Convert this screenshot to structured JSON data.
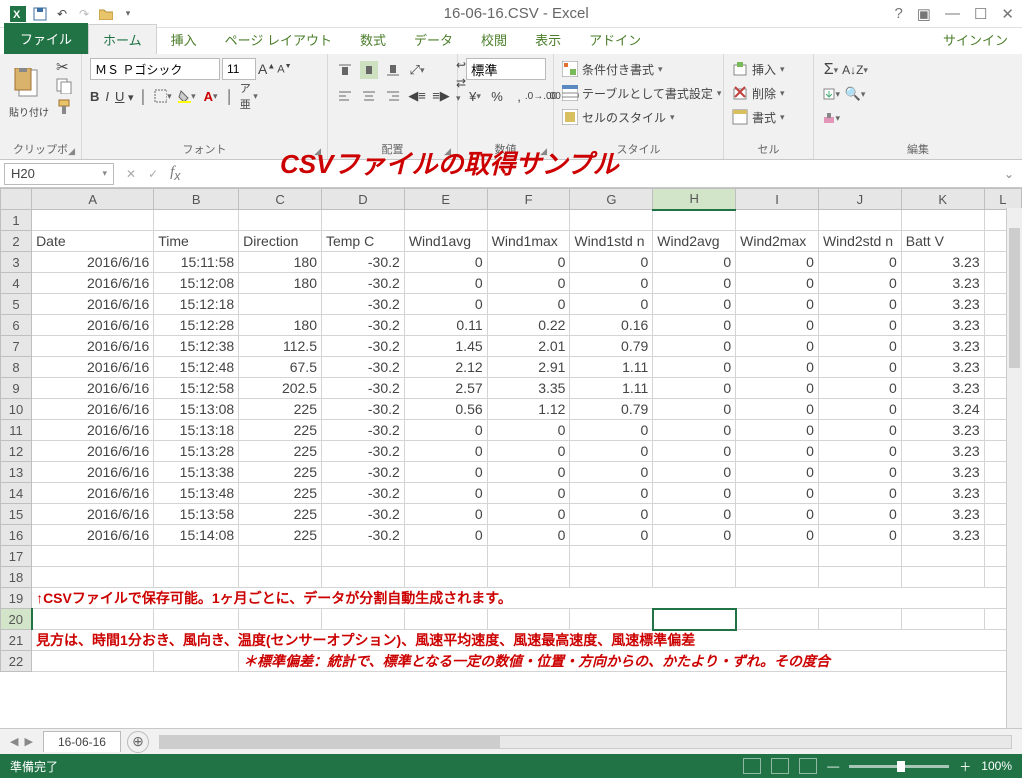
{
  "window": {
    "title": "16-06-16.CSV - Excel",
    "signin": "サインイン",
    "help_glyph": "?"
  },
  "tabs": {
    "file": "ファイル",
    "home": "ホーム",
    "insert": "挿入",
    "pagelayout": "ページ レイアウト",
    "formulas": "数式",
    "data": "データ",
    "review": "校閲",
    "view": "表示",
    "addin": "アドイン"
  },
  "ribbon": {
    "clipboard": {
      "paste": "貼り付け",
      "label": "クリップボード"
    },
    "font": {
      "name": "ＭＳ Ｐゴシック",
      "size": "11",
      "label": "フォント"
    },
    "alignment": {
      "label": "配置",
      "wrap_glyph": "↩",
      "merge_glyph": "⇄"
    },
    "number": {
      "format": "標準",
      "label": "数値"
    },
    "styles": {
      "cond": "条件付き書式",
      "table": "テーブルとして書式設定",
      "cell": "セルのスタイル",
      "label": "スタイル"
    },
    "cells": {
      "insert": "挿入",
      "delete": "削除",
      "format": "書式",
      "label": "セル"
    },
    "editing": {
      "label": "編集"
    }
  },
  "fbar": {
    "namebox": "H20",
    "cancel": "✕",
    "enter": "✓",
    "overlay": "CSVファイルの取得サンプル"
  },
  "columns": [
    "A",
    "B",
    "C",
    "D",
    "E",
    "F",
    "G",
    "H",
    "I",
    "J",
    "K",
    "L"
  ],
  "headers": [
    "Date",
    "Time",
    "Direction",
    "Temp C",
    "Wind1avg",
    "Wind1max",
    "Wind1std n",
    "Wind2avg",
    "Wind2max",
    "Wind2std n",
    "Batt V"
  ],
  "rows": [
    [
      "2016/6/16",
      "15:11:58",
      "180",
      "-30.2",
      "0",
      "0",
      "0",
      "0",
      "0",
      "0",
      "3.23"
    ],
    [
      "2016/6/16",
      "15:12:08",
      "180",
      "-30.2",
      "0",
      "0",
      "0",
      "0",
      "0",
      "0",
      "3.23"
    ],
    [
      "2016/6/16",
      "15:12:18",
      "",
      "-30.2",
      "0",
      "0",
      "0",
      "0",
      "0",
      "0",
      "3.23"
    ],
    [
      "2016/6/16",
      "15:12:28",
      "180",
      "-30.2",
      "0.11",
      "0.22",
      "0.16",
      "0",
      "0",
      "0",
      "3.23"
    ],
    [
      "2016/6/16",
      "15:12:38",
      "112.5",
      "-30.2",
      "1.45",
      "2.01",
      "0.79",
      "0",
      "0",
      "0",
      "3.23"
    ],
    [
      "2016/6/16",
      "15:12:48",
      "67.5",
      "-30.2",
      "2.12",
      "2.91",
      "1.11",
      "0",
      "0",
      "0",
      "3.23"
    ],
    [
      "2016/6/16",
      "15:12:58",
      "202.5",
      "-30.2",
      "2.57",
      "3.35",
      "1.11",
      "0",
      "0",
      "0",
      "3.23"
    ],
    [
      "2016/6/16",
      "15:13:08",
      "225",
      "-30.2",
      "0.56",
      "1.12",
      "0.79",
      "0",
      "0",
      "0",
      "3.24"
    ],
    [
      "2016/6/16",
      "15:13:18",
      "225",
      "-30.2",
      "0",
      "0",
      "0",
      "0",
      "0",
      "0",
      "3.23"
    ],
    [
      "2016/6/16",
      "15:13:28",
      "225",
      "-30.2",
      "0",
      "0",
      "0",
      "0",
      "0",
      "0",
      "3.23"
    ],
    [
      "2016/6/16",
      "15:13:38",
      "225",
      "-30.2",
      "0",
      "0",
      "0",
      "0",
      "0",
      "0",
      "3.23"
    ],
    [
      "2016/6/16",
      "15:13:48",
      "225",
      "-30.2",
      "0",
      "0",
      "0",
      "0",
      "0",
      "0",
      "3.23"
    ],
    [
      "2016/6/16",
      "15:13:58",
      "225",
      "-30.2",
      "0",
      "0",
      "0",
      "0",
      "0",
      "0",
      "3.23"
    ],
    [
      "2016/6/16",
      "15:14:08",
      "225",
      "-30.2",
      "0",
      "0",
      "0",
      "0",
      "0",
      "0",
      "3.23"
    ]
  ],
  "notes": {
    "line1": "↑CSVファイルで保存可能。1ヶ月ごとに、データが分割自動生成されます。",
    "line2": "見方は、時間1分おき、風向き、温度(センサーオプション)、風速平均速度、風速最高速度、風速標準偏差",
    "line3": "＊標準偏差：統計で、標準となる一定の数値・位置・方向からの、かたより・ずれ。その度合"
  },
  "sheet": {
    "tab": "16-06-16"
  },
  "status": {
    "ready": "準備完了",
    "zoom": "100%"
  },
  "active": {
    "col": "H",
    "row": 20
  }
}
